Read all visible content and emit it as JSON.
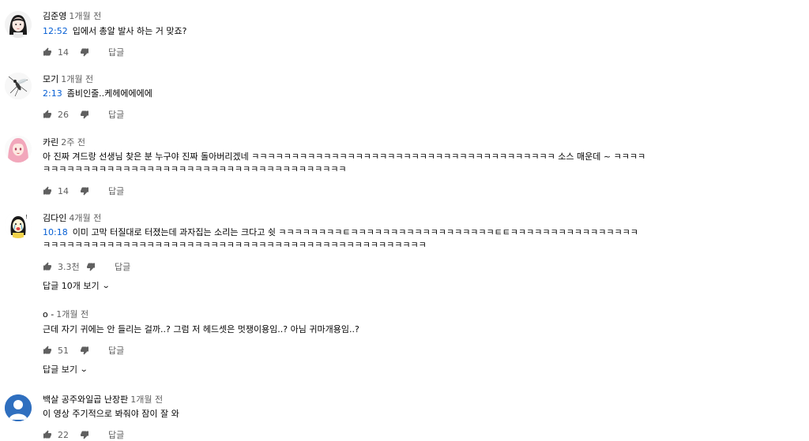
{
  "comments": [
    {
      "author": "김준영",
      "time": "1개월 전",
      "timestamp": "12:52",
      "text": "입에서 총알 발사 하는 거 맞죠?",
      "likes": "14",
      "reply_label": "답글",
      "avatar": "drawn-girl-avatar"
    },
    {
      "author": "모기",
      "time": "1개월 전",
      "timestamp": "2:13",
      "text": "좀비인줄..케헤에에에에",
      "likes": "26",
      "reply_label": "답글",
      "avatar": "mosquito-avatar"
    },
    {
      "author": "카린",
      "time": "2주 전",
      "timestamp": "",
      "text_line1": "아 진짜 겨드랑 선생님 찾은 분 누구야 진짜 돌아버리겠네 ㅋㅋㅋㅋㅋㅋㅋㅋㅋㅋㅋㅋㅋㅋㅋㅋㅋㅋㅋㅋㅋㅋㅋㅋㅋㅋㅋㅋㅋㅋㅋㅋㅋㅋㅋㅋㅋㅋ 소스 매운데 ~ ㅋㅋㅋㅋ",
      "text_line2": "ㅋㅋㅋㅋㅋㅋㅋㅋㅋㅋㅋㅋㅋㅋㅋㅋㅋㅋㅋㅋㅋㅋㅋㅋㅋㅋㅋㅋㅋㅋㅋㅋㅋㅋㅋㅋㅋㅋ",
      "likes": "14",
      "reply_label": "답글",
      "avatar": "pink-hair-anime-avatar"
    },
    {
      "author": "김다인",
      "time": "4개월 전",
      "timestamp": "10:18",
      "text_line1": "이미 고막 터질대로 터졌는데 과자집는 소리는 크다고 쉿 ㅋㅋㅋㅋㅋㅋㅋㅋㅌㅋㅋㅋㅋㅋㅋㅋㅋㅋㅋㅋㅋㅋㅋㅋㅋㅋㅋㅌㅌㅋㅋㅋㅋㅋㅋㅋㅋㅋㅋㅋㅋㅋㅋㅋㅋ",
      "text_line2": "ㅋㅋㅋㅋㅋㅋㅋㅋㅋㅋㅋㅋㅋㅋㅋㅋㅋㅋㅋㅋㅋㅋㅋㅋㅋㅋㅋㅋㅋㅋㅋㅋㅋㅋㅋㅋㅋㅋㅋㅋㅋㅋㅋㅋㅋㅋㅋㅋ",
      "likes": "3.3천",
      "reply_label": "답글",
      "replies_label": "답글 10개 보기",
      "avatar": "crying-girl-doodle-avatar"
    },
    {
      "author": "o -",
      "time": "1개월 전",
      "text": "근데 자기 귀에는 안 들리는 걸까..? 그럼 저 헤드셋은 멋쟁이용임..? 아님 귀마개용임..?",
      "likes": "51",
      "reply_label": "답글",
      "replies_label": "답글 보기"
    },
    {
      "author": "백살 공주와일곱 난장판",
      "time": "1개월 전",
      "text": "이 영상 주기적으로 봐줘야 잠이 잘 와",
      "likes": "22",
      "reply_label": "답글",
      "avatar": "default-user-avatar"
    }
  ],
  "colors": {
    "timestamp_link": "#065fd4",
    "secondary_text": "#606060",
    "default_avatar": "#2f6fbf"
  }
}
